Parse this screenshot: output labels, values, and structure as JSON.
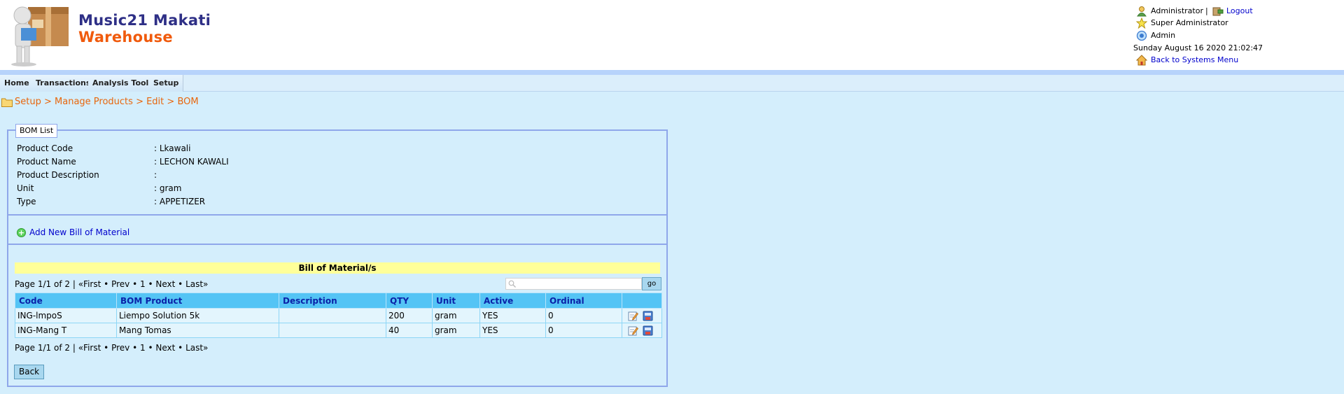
{
  "app": {
    "title_line1": "Music21 Makati",
    "title_line2": "Warehouse"
  },
  "user": {
    "name": "Administrator",
    "separator": "|",
    "logout": "Logout",
    "role": "Super Administrator",
    "group": "Admin",
    "datetime": "Sunday August 16 2020 21:02:47",
    "back_link": "Back to Systems Menu"
  },
  "nav": [
    "Home",
    "Transactions",
    "Analysis Tools",
    "Setup"
  ],
  "breadcrumb": [
    "Setup",
    "Manage Products",
    "Edit",
    "BOM"
  ],
  "panel": {
    "legend": "BOM List",
    "fields": [
      {
        "label": "Product Code",
        "value": ": Lkawali"
      },
      {
        "label": "Product Name",
        "value": ": LECHON KAWALI"
      },
      {
        "label": "Product Description",
        "value": ":"
      },
      {
        "label": "Unit",
        "value": ": gram"
      },
      {
        "label": "Type",
        "value": ": APPETIZER"
      }
    ],
    "add_new": "Add New Bill of Material"
  },
  "bom": {
    "title": "Bill of Material/s",
    "pager_info": "Page 1/1 of 2",
    "pager_sep": "|",
    "first": "«First",
    "prev": "Prev",
    "page": "1",
    "next": "Next",
    "last": "Last»",
    "search_placeholder": "",
    "go": "go",
    "columns": [
      "Code",
      "BOM Product",
      "Description",
      "QTY",
      "Unit",
      "Active",
      "Ordinal",
      ""
    ],
    "rows": [
      {
        "code": "ING-lmpoS",
        "product": "Liempo Solution 5k",
        "description": "",
        "qty": "200",
        "unit": "gram",
        "active": "YES",
        "ordinal": "0"
      },
      {
        "code": "ING-Mang T",
        "product": "Mang Tomas",
        "description": "",
        "qty": "40",
        "unit": "gram",
        "active": "YES",
        "ordinal": "0"
      }
    ],
    "back": "Back"
  },
  "icons": {
    "user": "user-icon",
    "logout": "logout-icon",
    "role": "star-icon",
    "group": "group-icon",
    "home": "home-icon",
    "folder": "folder-icon",
    "add": "plus-circle-icon",
    "search": "magnifier-icon",
    "edit": "edit-icon",
    "delete": "delete-icon"
  }
}
